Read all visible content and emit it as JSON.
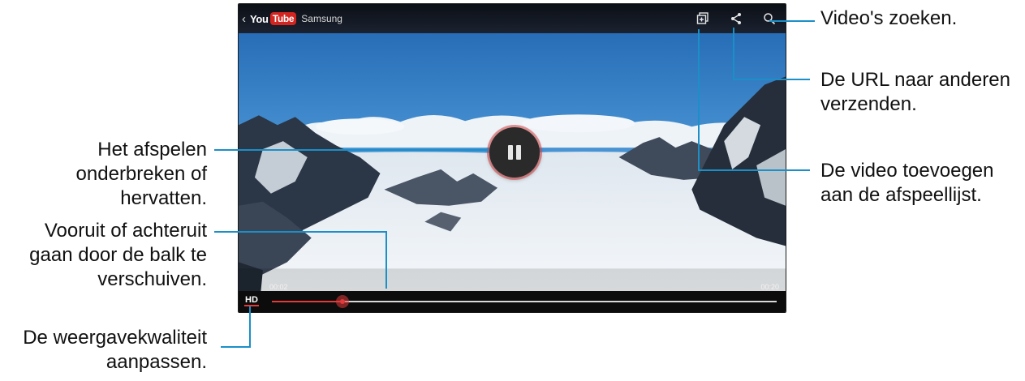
{
  "app": {
    "back_glyph": "‹",
    "logo_you": "You",
    "logo_tube": "Tube",
    "channel_name": "Samsung"
  },
  "toolbar": {
    "icons": [
      "add-to-playlist-icon",
      "share-icon",
      "search-icon"
    ]
  },
  "player": {
    "elapsed": "00:02",
    "total": "00:20",
    "quality_label": "HD",
    "progress_fraction": 0.14,
    "state": "playing"
  },
  "colors": {
    "accent": "#e03a3a",
    "callout_line": "#1b8fc7",
    "logo_red": "#d32420"
  },
  "annotations": {
    "search": "Video's zoeken.",
    "share_line1": "De URL naar anderen",
    "share_line2": "verzenden.",
    "playlist_line1": "De video toevoegen",
    "playlist_line2": "aan de afspeellijst.",
    "pause_line1": "Het afspelen",
    "pause_line2": "onderbreken of",
    "pause_line3": "hervatten.",
    "seek_line1": "Vooruit of achteruit",
    "seek_line2": "gaan door de balk te",
    "seek_line3": "verschuiven.",
    "quality_line1": "De weergavekwaliteit",
    "quality_line2": "aanpassen."
  }
}
